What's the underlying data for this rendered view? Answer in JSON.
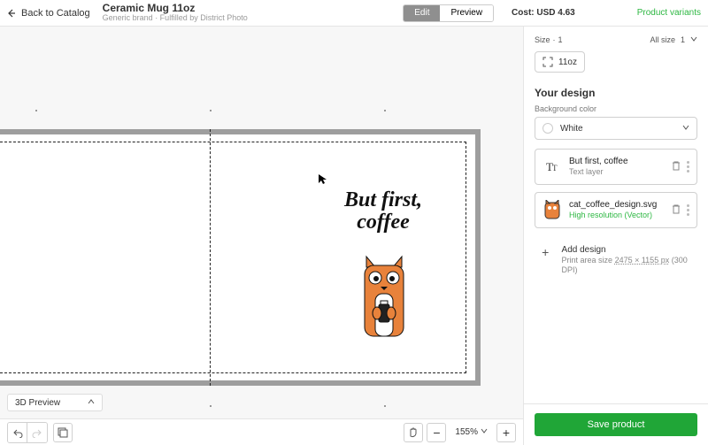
{
  "header": {
    "back": "Back to Catalog",
    "title": "Ceramic Mug 11oz",
    "subtitle": "Generic brand · Fulfilled by District Photo",
    "edit": "Edit",
    "preview": "Preview",
    "cost": "Cost: USD 4.63",
    "variants": "Product variants"
  },
  "canvas": {
    "text1": "But first,",
    "text2": "coffee",
    "threeD": "3D Preview",
    "zoom": "155%"
  },
  "right": {
    "size_label": "Size",
    "size_count": "1",
    "all_size": "All size",
    "all_size_count": "1",
    "chip": "11oz",
    "your_design": "Your design",
    "bg_label": "Background color",
    "bg_value": "White",
    "layers": [
      {
        "name": "But first, coffee",
        "sub": "Text layer",
        "green": false,
        "icon": "text"
      },
      {
        "name": "cat_coffee_design.svg",
        "sub": "High resolution (Vector)",
        "green": true,
        "icon": "cat"
      }
    ],
    "add": {
      "title": "Add design",
      "sub_a": "Print area size ",
      "sub_dim": "2475 × 1155 px",
      "sub_b": " (300 DPI)"
    },
    "save": "Save product"
  }
}
